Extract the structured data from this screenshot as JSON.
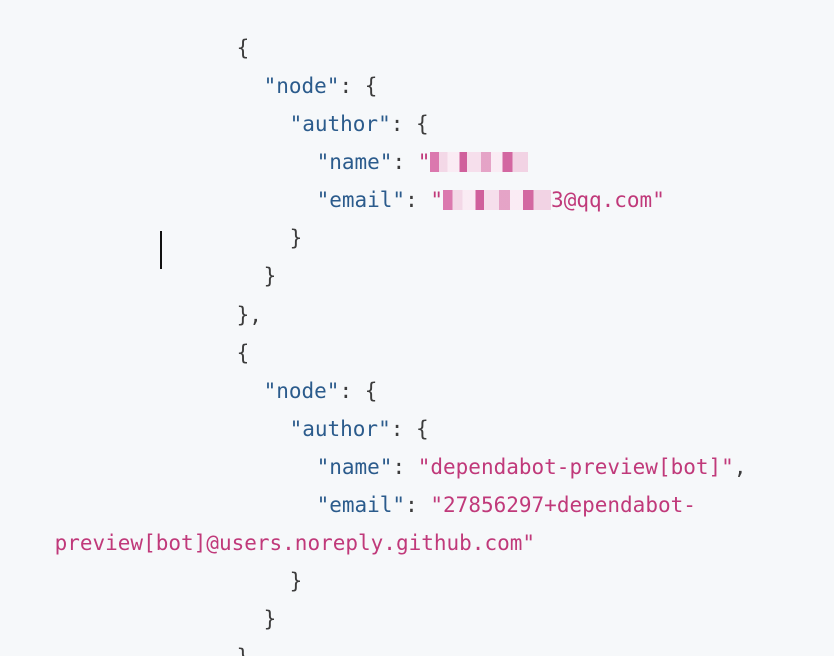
{
  "code": {
    "brace_open": "{",
    "brace_close": "}",
    "brace_close_comma": "},",
    "node_key": "\"node\"",
    "author_key": "\"author\"",
    "name_key": "\"name\"",
    "email_key": "\"email\"",
    "colon_brace": ": {",
    "colon": ": ",
    "comma": ",",
    "quote": "\"",
    "entry1": {
      "email_suffix": "3@qq.com\""
    },
    "entry2": {
      "name_value": "\"dependabot-preview[bot]\"",
      "email_value_part1": "\"27856297+dependabot-",
      "email_value_part2": "preview[bot]@users.noreply.github.com\""
    }
  },
  "colors": {
    "background": "#f6f8fa",
    "key": "#2b5b8c",
    "string": "#c0397a",
    "punctuation": "#3c3c3c"
  }
}
